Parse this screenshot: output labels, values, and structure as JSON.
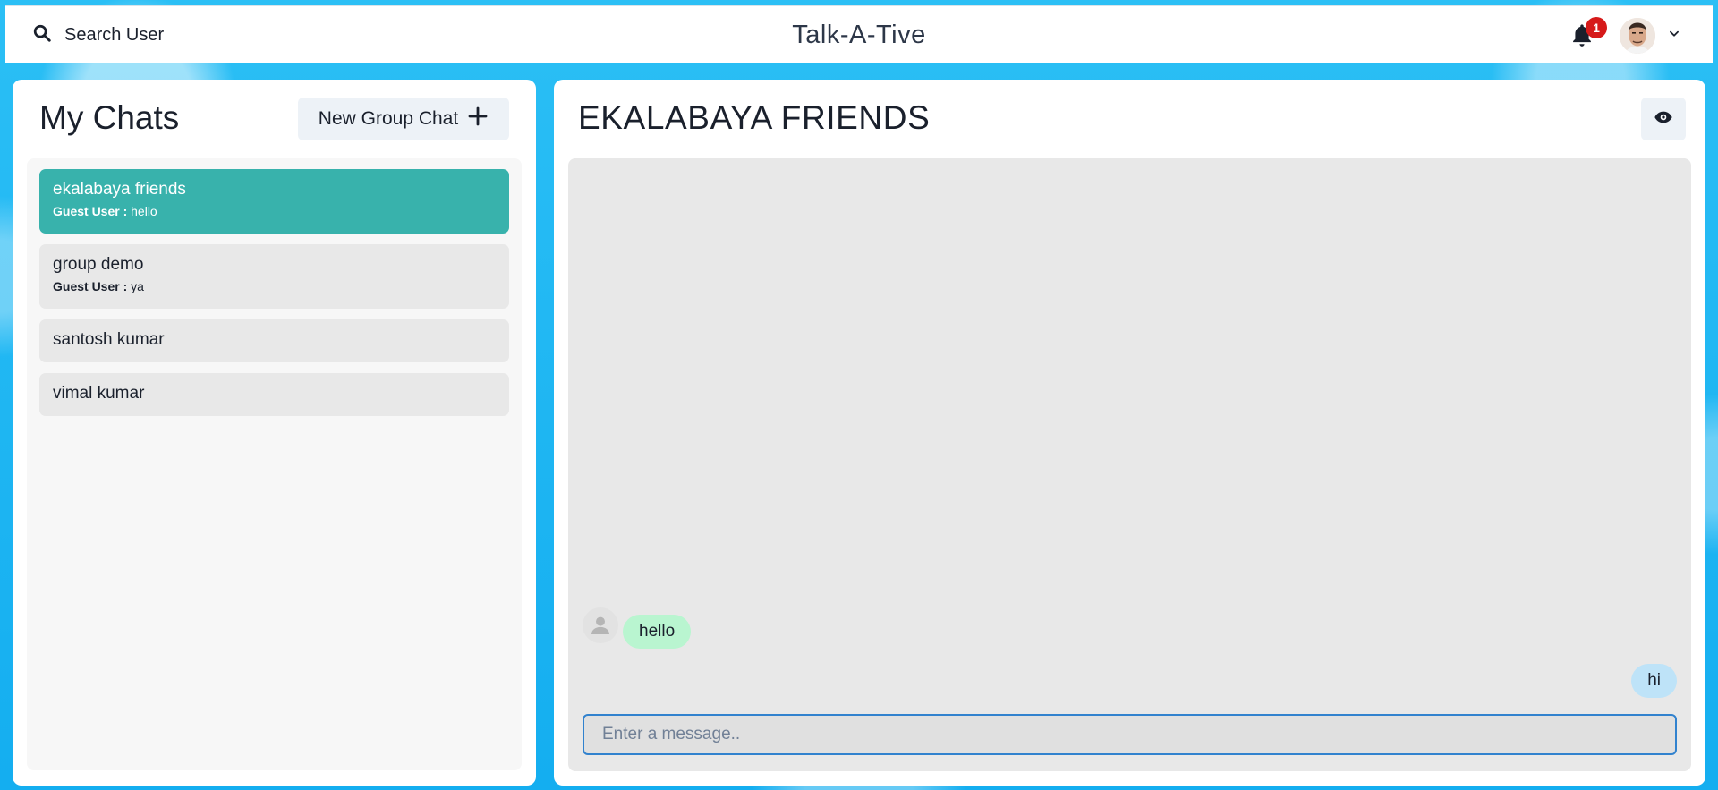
{
  "header": {
    "search_label": "Search User",
    "app_title": "Talk-A-Tive",
    "notification_count": "1",
    "search_icon": "search-icon",
    "bell_icon": "bell-icon"
  },
  "left_panel": {
    "title": "My Chats",
    "new_group_label": "New Group Chat",
    "chats": [
      {
        "name": "ekalabaya friends",
        "sender": "Guest User :",
        "latest": "hello",
        "active": true
      },
      {
        "name": "group demo",
        "sender": "Guest User :",
        "latest": "ya",
        "active": false
      },
      {
        "name": "santosh kumar"
      },
      {
        "name": "vimal kumar"
      }
    ]
  },
  "right_panel": {
    "chat_title": "EKALABAYA FRIENDS",
    "messages": [
      {
        "text": "hello",
        "direction": "received"
      },
      {
        "text": "hi",
        "direction": "sent"
      }
    ],
    "input_placeholder": "Enter a message.."
  },
  "colors": {
    "accent_active_chat": "#38b2ac",
    "received_bubble": "#b9f5d0",
    "sent_bubble": "#bee3f8",
    "badge": "#d61a1a",
    "input_focus": "#3182ce"
  }
}
